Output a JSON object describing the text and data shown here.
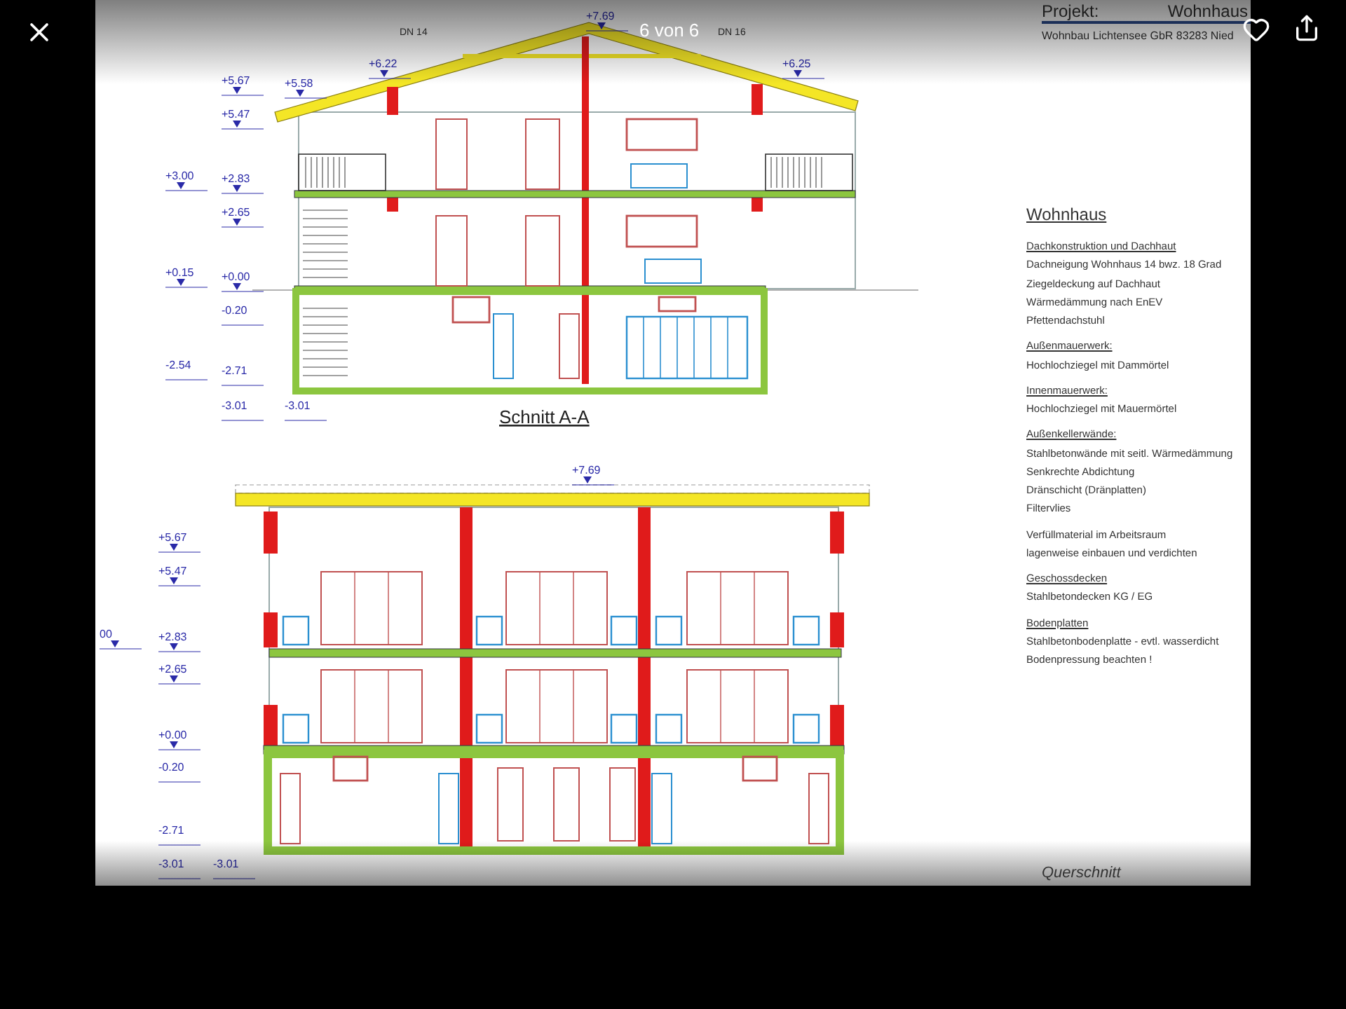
{
  "viewer": {
    "counter": "6 von 6"
  },
  "document": {
    "project": {
      "label": "Projekt:",
      "name": "Wohnhaus",
      "address": "Wohnbau Lichtensee GbR 83283 Nied"
    },
    "section_a": {
      "roof_labels": [
        "DN 14",
        "DN 16"
      ],
      "elevations": [
        "+7.69",
        "+6.22",
        "+6.25",
        "+5.58",
        "+5.67",
        "+5.47",
        "+3.00",
        "+2.83",
        "+2.65",
        "+0.15",
        "+0.00",
        "-0.20",
        "-2.54",
        "-2.71",
        "-3.01",
        "-3.01"
      ],
      "title": "Schnitt A-A"
    },
    "section_b": {
      "elevations": [
        "+7.69",
        "+5.67",
        "+5.47",
        "00",
        "+2.83",
        "+2.65",
        "+0.00",
        "-0.20",
        "-2.71",
        "-3.01",
        "-3.01"
      ]
    },
    "notes": {
      "title": "Wohnhaus",
      "groups": [
        {
          "heading": "Dachkonstruktion und Dachhaut",
          "lines": [
            "Dachneigung Wohnhaus  14 bwz. 18 Grad",
            "Ziegeldeckung auf Dachhaut",
            "Wärmedämmung nach EnEV",
            "Pfettendachstuhl"
          ]
        },
        {
          "heading": "Außenmauerwerk:",
          "lines": [
            "Hochlochziegel mit Dammörtel"
          ]
        },
        {
          "heading": "Innenmauerwerk:",
          "lines": [
            "Hochlochziegel mit Mauermörtel"
          ]
        },
        {
          "heading": "Außenkellerwände:",
          "lines": [
            "Stahlbetonwände mit seitl. Wärmedämmung",
            "Senkrechte Abdichtung",
            "Dränschicht (Dränplatten)",
            "Filtervlies"
          ]
        },
        {
          "lines": [
            "Verfüllmaterial im Arbeitsraum",
            "lagenweise einbauen und verdichten"
          ]
        },
        {
          "heading": "Geschossdecken",
          "lines": [
            "Stahlbetondecken KG / EG"
          ]
        },
        {
          "heading": "Bodenplatten",
          "lines": [
            "Stahlbetonbodenplatte - evtl. wasserdicht",
            "Bodenpressung beachten !"
          ]
        }
      ]
    },
    "footer_title": "Querschnitt"
  }
}
